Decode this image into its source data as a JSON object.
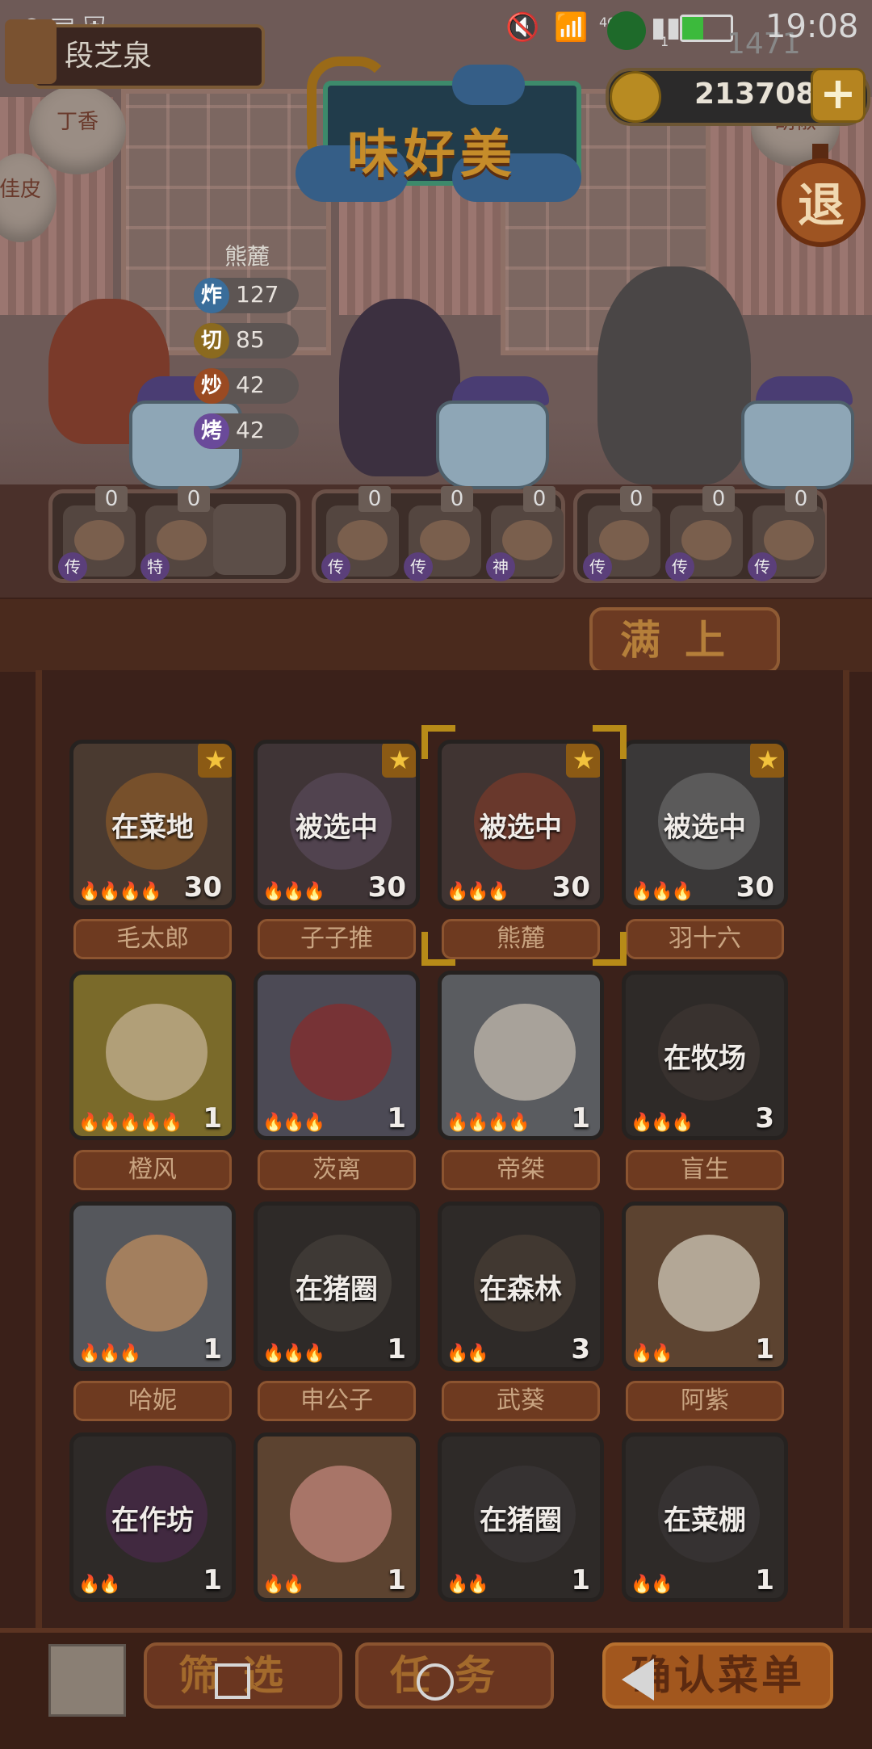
{
  "status_bar": {
    "time": "19:08",
    "network": "4G+",
    "sim": "1",
    "overlay_number": "1471"
  },
  "player": {
    "name": "段芝泉"
  },
  "currency": {
    "coins": "213708",
    "add_label": "+"
  },
  "sign": {
    "title": "味好美"
  },
  "exit": {
    "label": "退"
  },
  "lanterns": {
    "left_top": "丁香",
    "left_bottom": "佳皮",
    "right_top": "胡椒"
  },
  "stats": {
    "chef_name": "熊麓",
    "rows": [
      {
        "icon_label": "炸",
        "value": "127",
        "color": "#3a6d9a"
      },
      {
        "icon_label": "切",
        "value": "85",
        "color": "#8b6a1f"
      },
      {
        "icon_label": "炒",
        "value": "42",
        "color": "#9a4a22"
      },
      {
        "icon_label": "烤",
        "value": "42",
        "color": "#6a4a9a"
      }
    ]
  },
  "trays": [
    {
      "dishes": [
        {
          "count": "0",
          "tag": "传"
        },
        {
          "count": "0",
          "tag": "特"
        }
      ]
    },
    {
      "dishes": [
        {
          "count": "0",
          "tag": "传"
        },
        {
          "count": "0",
          "tag": "传"
        },
        {
          "count": "0",
          "tag": "神"
        }
      ]
    },
    {
      "dishes": [
        {
          "count": "0",
          "tag": "传"
        },
        {
          "count": "0",
          "tag": "传"
        },
        {
          "count": "0",
          "tag": "传"
        }
      ]
    }
  ],
  "fill_button": {
    "label": "满上"
  },
  "cards": [
    {
      "name": "毛太郎",
      "status": "在菜地",
      "level": "30",
      "flames": "🔥🔥🔥🔥",
      "star": true,
      "bg": "#4a3a30",
      "face": "#8a5a2a"
    },
    {
      "name": "子子推",
      "status": "被选中",
      "level": "30",
      "flames": "🔥🔥🔥",
      "star": true,
      "bg": "#3f3436",
      "face": "#5a4a5a"
    },
    {
      "name": "熊麓",
      "status": "被选中",
      "level": "30",
      "flames": "🔥🔥🔥",
      "star": true,
      "bg": "#403432",
      "face": "#7a3a2a"
    },
    {
      "name": "羽十六",
      "status": "被选中",
      "level": "30",
      "flames": "🔥🔥🔥",
      "star": true,
      "bg": "#3a3838",
      "face": "#6a6a6a"
    },
    {
      "name": "橙风",
      "status": "",
      "level": "1",
      "flames": "🔥🔥🔥🔥🔥",
      "star": false,
      "bg": "#7a6a2a",
      "face": "#c9b79a"
    },
    {
      "name": "茨离",
      "status": "",
      "level": "1",
      "flames": "🔥🔥🔥",
      "star": false,
      "bg": "#4c4a55",
      "face": "#8a2a2a"
    },
    {
      "name": "帝桀",
      "status": "",
      "level": "1",
      "flames": "🔥🔥🔥🔥",
      "star": false,
      "bg": "#5a5c60",
      "face": "#c9c1b4"
    },
    {
      "name": "盲生",
      "status": "在牧场",
      "level": "3",
      "flames": "🔥🔥🔥",
      "star": false,
      "bg": "#2e2a28",
      "face": "#3e3632"
    },
    {
      "name": "哈妮",
      "status": "",
      "level": "1",
      "flames": "🔥🔥🔥",
      "star": false,
      "bg": "#55575c",
      "face": "#c49060"
    },
    {
      "name": "申公子",
      "status": "在猪圈",
      "level": "1",
      "flames": "🔥🔥🔥",
      "star": false,
      "bg": "#2e2a28",
      "face": "#46403a"
    },
    {
      "name": "武葵",
      "status": "在森林",
      "level": "3",
      "flames": "🔥🔥",
      "star": false,
      "bg": "#2e2a28",
      "face": "#4a3f34"
    },
    {
      "name": "阿紫",
      "status": "",
      "level": "1",
      "flames": "🔥🔥",
      "star": false,
      "bg": "#5c4330",
      "face": "#d9d2c2"
    },
    {
      "name": "",
      "status": "在作坊",
      "level": "1",
      "flames": "🔥🔥",
      "star": false,
      "bg": "#2e2a28",
      "face": "#4a2a4a"
    },
    {
      "name": "",
      "status": "",
      "level": "1",
      "flames": "🔥🔥",
      "star": false,
      "bg": "#5c4330",
      "face": "#c98a80"
    },
    {
      "name": "",
      "status": "在猪圈",
      "level": "1",
      "flames": "🔥🔥",
      "star": false,
      "bg": "#2e2a28",
      "face": "#3a3636"
    },
    {
      "name": "",
      "status": "在菜棚",
      "level": "1",
      "flames": "🔥🔥",
      "star": false,
      "bg": "#2e2a28",
      "face": "#3a3636"
    }
  ],
  "bottom": {
    "filter_label": "筛选",
    "task_label": "任务",
    "confirm_label": "确认菜单"
  },
  "colors": {
    "accent": "#b78b18",
    "panel": "#3b211a"
  }
}
